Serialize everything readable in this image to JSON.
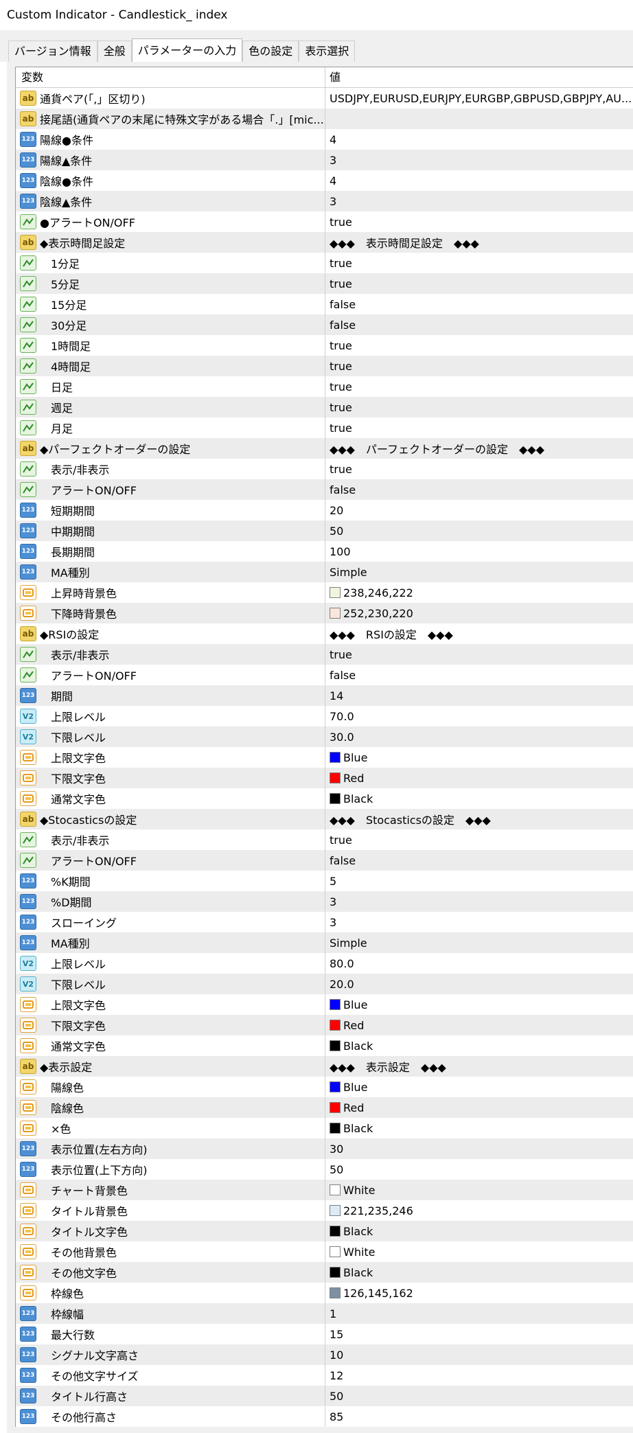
{
  "window": {
    "title": "Custom Indicator - Candlestick_ index"
  },
  "tabs": [
    {
      "label": "バージョン情報",
      "active": false
    },
    {
      "label": "全般",
      "active": false
    },
    {
      "label": "パラメーターの入力",
      "active": true
    },
    {
      "label": "色の設定",
      "active": false
    },
    {
      "label": "表示選択",
      "active": false
    }
  ],
  "table": {
    "col_variable": "変数",
    "col_value": "値",
    "rows": [
      {
        "icon": "ab",
        "indent": false,
        "name": "通貨ペア(「,」区切り)",
        "value": "USDJPY,EURUSD,EURJPY,EURGBP,GBPUSD,GBPJPY,AU..."
      },
      {
        "icon": "ab",
        "indent": false,
        "name": "接尾語(通貨ペアの末尾に特殊文字がある場合「.」[mic...",
        "value": ""
      },
      {
        "icon": "123",
        "indent": false,
        "name": "陽線●条件",
        "value": "4"
      },
      {
        "icon": "123",
        "indent": false,
        "name": "陽線▲条件",
        "value": "3"
      },
      {
        "icon": "123",
        "indent": false,
        "name": "陰線●条件",
        "value": "4"
      },
      {
        "icon": "123",
        "indent": false,
        "name": "陰線▲条件",
        "value": "3"
      },
      {
        "icon": "bool",
        "indent": false,
        "name": "●アラートON/OFF",
        "value": "true"
      },
      {
        "icon": "ab",
        "indent": false,
        "name": "◆表示時間足設定",
        "value": "◆◆◆　表示時間足設定　◆◆◆"
      },
      {
        "icon": "bool",
        "indent": true,
        "name": "1分足",
        "value": "true"
      },
      {
        "icon": "bool",
        "indent": true,
        "name": "5分足",
        "value": "true"
      },
      {
        "icon": "bool",
        "indent": true,
        "name": "15分足",
        "value": "false"
      },
      {
        "icon": "bool",
        "indent": true,
        "name": "30分足",
        "value": "false"
      },
      {
        "icon": "bool",
        "indent": true,
        "name": "1時間足",
        "value": "true"
      },
      {
        "icon": "bool",
        "indent": true,
        "name": "4時間足",
        "value": "true"
      },
      {
        "icon": "bool",
        "indent": true,
        "name": "日足",
        "value": "true"
      },
      {
        "icon": "bool",
        "indent": true,
        "name": "週足",
        "value": "true"
      },
      {
        "icon": "bool",
        "indent": true,
        "name": "月足",
        "value": "true"
      },
      {
        "icon": "ab",
        "indent": false,
        "name": "◆パーフェクトオーダーの設定",
        "value": "◆◆◆　パーフェクトオーダーの設定　◆◆◆"
      },
      {
        "icon": "bool",
        "indent": true,
        "name": "表示/非表示",
        "value": "true"
      },
      {
        "icon": "bool",
        "indent": true,
        "name": "アラートON/OFF",
        "value": "false"
      },
      {
        "icon": "123",
        "indent": true,
        "name": "短期期間",
        "value": "20"
      },
      {
        "icon": "123",
        "indent": true,
        "name": "中期期間",
        "value": "50"
      },
      {
        "icon": "123",
        "indent": true,
        "name": "長期期間",
        "value": "100"
      },
      {
        "icon": "123",
        "indent": true,
        "name": "MA種別",
        "value": "Simple"
      },
      {
        "icon": "color",
        "indent": true,
        "name": "上昇時背景色",
        "value": "238,246,222",
        "swatch": "#eef6de"
      },
      {
        "icon": "color",
        "indent": true,
        "name": "下降時背景色",
        "value": "252,230,220",
        "swatch": "#fce6dc"
      },
      {
        "icon": "ab",
        "indent": false,
        "name": "◆RSIの設定",
        "value": "◆◆◆　RSIの設定　◆◆◆"
      },
      {
        "icon": "bool",
        "indent": true,
        "name": "表示/非表示",
        "value": "true"
      },
      {
        "icon": "bool",
        "indent": true,
        "name": "アラートON/OFF",
        "value": "false"
      },
      {
        "icon": "123",
        "indent": true,
        "name": "期間",
        "value": "14"
      },
      {
        "icon": "v2",
        "indent": true,
        "name": "上限レベル",
        "value": "70.0"
      },
      {
        "icon": "v2",
        "indent": true,
        "name": "下限レベル",
        "value": "30.0"
      },
      {
        "icon": "color",
        "indent": true,
        "name": "上限文字色",
        "value": "Blue",
        "swatch": "#0000ff"
      },
      {
        "icon": "color",
        "indent": true,
        "name": "下限文字色",
        "value": "Red",
        "swatch": "#ff0000"
      },
      {
        "icon": "color",
        "indent": true,
        "name": "通常文字色",
        "value": "Black",
        "swatch": "#000000"
      },
      {
        "icon": "ab",
        "indent": false,
        "name": "◆Stocasticsの設定",
        "value": "◆◆◆　Stocasticsの設定　◆◆◆"
      },
      {
        "icon": "bool",
        "indent": true,
        "name": "表示/非表示",
        "value": "true"
      },
      {
        "icon": "bool",
        "indent": true,
        "name": "アラートON/OFF",
        "value": "false"
      },
      {
        "icon": "123",
        "indent": true,
        "name": "%K期間",
        "value": "5"
      },
      {
        "icon": "123",
        "indent": true,
        "name": "%D期間",
        "value": "3"
      },
      {
        "icon": "123",
        "indent": true,
        "name": "スローイング",
        "value": "3"
      },
      {
        "icon": "123",
        "indent": true,
        "name": "MA種別",
        "value": "Simple"
      },
      {
        "icon": "v2",
        "indent": true,
        "name": "上限レベル",
        "value": "80.0"
      },
      {
        "icon": "v2",
        "indent": true,
        "name": "下限レベル",
        "value": "20.0"
      },
      {
        "icon": "color",
        "indent": true,
        "name": "上限文字色",
        "value": "Blue",
        "swatch": "#0000ff"
      },
      {
        "icon": "color",
        "indent": true,
        "name": "下限文字色",
        "value": "Red",
        "swatch": "#ff0000"
      },
      {
        "icon": "color",
        "indent": true,
        "name": "通常文字色",
        "value": "Black",
        "swatch": "#000000"
      },
      {
        "icon": "ab",
        "indent": false,
        "name": "◆表示設定",
        "value": "◆◆◆　表示設定　◆◆◆"
      },
      {
        "icon": "color",
        "indent": true,
        "name": "陽線色",
        "value": "Blue",
        "swatch": "#0000ff"
      },
      {
        "icon": "color",
        "indent": true,
        "name": "陰線色",
        "value": "Red",
        "swatch": "#ff0000"
      },
      {
        "icon": "color",
        "indent": true,
        "name": "×色",
        "value": "Black",
        "swatch": "#000000"
      },
      {
        "icon": "123",
        "indent": true,
        "name": "表示位置(左右方向)",
        "value": "30"
      },
      {
        "icon": "123",
        "indent": true,
        "name": "表示位置(上下方向)",
        "value": "50"
      },
      {
        "icon": "color",
        "indent": true,
        "name": "チャート背景色",
        "value": "White",
        "swatch": "#ffffff"
      },
      {
        "icon": "color",
        "indent": true,
        "name": "タイトル背景色",
        "value": "221,235,246",
        "swatch": "#ddebf6"
      },
      {
        "icon": "color",
        "indent": true,
        "name": "タイトル文字色",
        "value": "Black",
        "swatch": "#000000"
      },
      {
        "icon": "color",
        "indent": true,
        "name": "その他背景色",
        "value": "White",
        "swatch": "#ffffff"
      },
      {
        "icon": "color",
        "indent": true,
        "name": "その他文字色",
        "value": "Black",
        "swatch": "#000000"
      },
      {
        "icon": "color",
        "indent": true,
        "name": "枠線色",
        "value": "126,145,162",
        "swatch": "#7e91a2"
      },
      {
        "icon": "123",
        "indent": true,
        "name": "枠線幅",
        "value": "1"
      },
      {
        "icon": "123",
        "indent": true,
        "name": "最大行数",
        "value": "15"
      },
      {
        "icon": "123",
        "indent": true,
        "name": "シグナル文字高さ",
        "value": "10"
      },
      {
        "icon": "123",
        "indent": true,
        "name": " その他文字サイズ",
        "value": "12"
      },
      {
        "icon": "123",
        "indent": true,
        "name": "タイトル行高さ",
        "value": "50"
      },
      {
        "icon": "123",
        "indent": true,
        "name": "その他行高さ",
        "value": "85"
      }
    ]
  }
}
